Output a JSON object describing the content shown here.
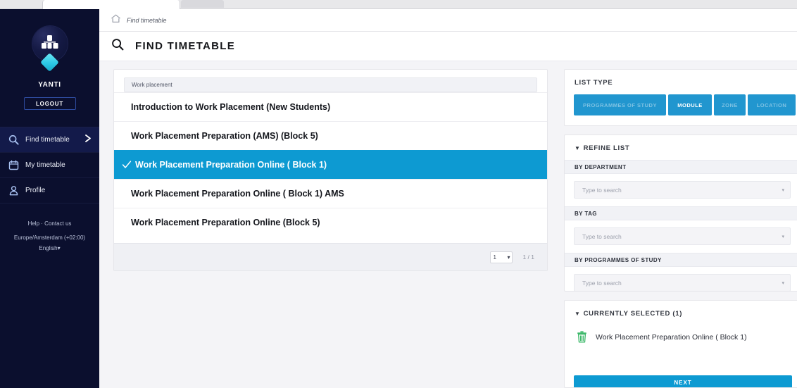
{
  "sidebar": {
    "avatar_icon": "org-hierarchy-icon",
    "user_name": "YANTI",
    "logout_label": "LOGOUT",
    "nav_items": [
      {
        "label": "Find timetable",
        "icon": "search-icon",
        "active": true
      },
      {
        "label": "My timetable",
        "icon": "calendar-icon",
        "active": false
      },
      {
        "label": "Profile",
        "icon": "user-icon",
        "active": false
      }
    ],
    "footer": {
      "help_label": "Help",
      "separator": "·",
      "contact_label": "Contact us",
      "timezone": "Europe/Amsterdam (+02:00)",
      "language": "English",
      "language_caret": "▾"
    }
  },
  "breadcrumb": {
    "home_icon": "home-icon",
    "text": "Find timetable"
  },
  "header": {
    "search_icon": "search-icon",
    "title": "FIND TIMETABLE"
  },
  "results": {
    "search_value": "Work placement",
    "search_placeholder": "Type to search",
    "rows": [
      {
        "label": "Introduction to Work Placement (New Students)",
        "selected": false
      },
      {
        "label": "Work Placement Preparation (AMS) (Block 5)",
        "selected": false
      },
      {
        "label": "Work Placement Preparation Online ( Block 1)",
        "selected": true
      },
      {
        "label": "Work Placement Preparation Online ( Block 1) AMS",
        "selected": false
      },
      {
        "label": "Work Placement Preparation Online (Block 5)",
        "selected": false
      }
    ],
    "pager": {
      "page_value": "1",
      "caret": "▾",
      "count_label": "1 / 1"
    }
  },
  "list_type": {
    "title": "LIST TYPE",
    "tabs": [
      {
        "label": "PROGRAMMES OF STUDY",
        "active": false
      },
      {
        "label": "MODULE",
        "active": true
      },
      {
        "label": "ZONE",
        "active": false
      },
      {
        "label": "LOCATION",
        "active": false
      }
    ]
  },
  "refine": {
    "caret": "▼",
    "title": "REFINE LIST",
    "filters": [
      {
        "label": "BY DEPARTMENT",
        "placeholder": "Type to search",
        "value": "",
        "arrow": "▾"
      },
      {
        "label": "BY TAG",
        "placeholder": "Type to search",
        "value": "",
        "arrow": "▾"
      },
      {
        "label": "BY PROGRAMMES OF STUDY",
        "placeholder": "Type to search",
        "value": "",
        "arrow": "▾"
      }
    ]
  },
  "currently_selected": {
    "caret": "▼",
    "title": "CURRENTLY SELECTED (1)",
    "items": [
      {
        "label": "Work Placement Preparation Online ( Block 1)",
        "delete_icon": "trash-icon"
      }
    ],
    "next_label": "NEXT"
  },
  "colors": {
    "sidebar_bg": "#0b0f2e",
    "accent_blue": "#0d9ad2",
    "tab_blue": "#2196cf",
    "trash_green": "#3fb96b",
    "page_bg": "#f4f4f7"
  }
}
